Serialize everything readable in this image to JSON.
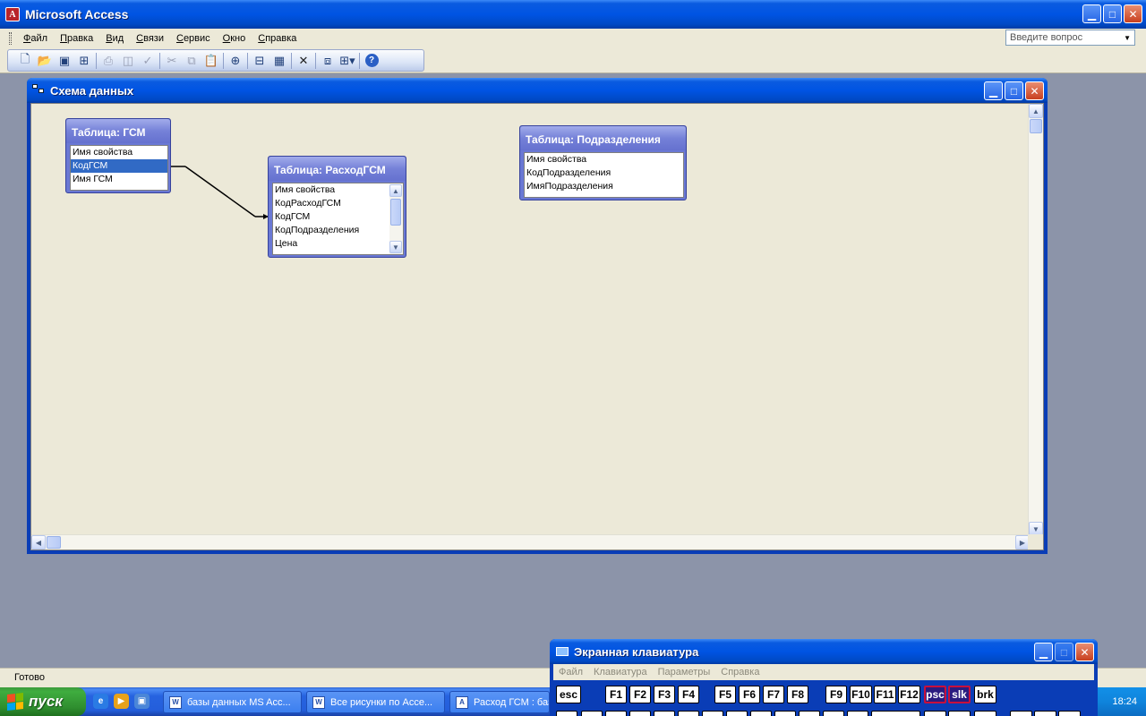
{
  "app": {
    "title": "Microsoft Access"
  },
  "menubar": {
    "items": [
      "Файл",
      "Правка",
      "Вид",
      "Связи",
      "Сервис",
      "Окно",
      "Справка"
    ],
    "ask_placeholder": "Введите вопрос"
  },
  "toolbar": {
    "buttons": [
      "new-icon",
      "open-icon",
      "save-icon",
      "table-prop-icon",
      "print-icon",
      "preview-icon",
      "spellcheck-icon",
      "cut-icon",
      "copy-icon",
      "paste-icon",
      "show-table-icon",
      "direct-relations-icon",
      "all-relations-icon",
      "delete-icon",
      "database-window-icon",
      "new-object-icon",
      "help-icon"
    ]
  },
  "window": {
    "title": "Схема данных"
  },
  "tables": [
    {
      "title": "Таблица: ГСМ",
      "fields": [
        "Имя свойства",
        "КодГСМ",
        "Имя ГСМ"
      ],
      "selected": 1
    },
    {
      "title": "Таблица: РасходГСМ",
      "fields": [
        "Имя свойства",
        "КодРасходГСМ",
        "КодГСМ",
        "КодПодразделения",
        "Цена"
      ],
      "selected": -1
    },
    {
      "title": "Таблица: Подразделения",
      "fields": [
        "Имя свойства",
        "КодПодразделения",
        "ИмяПодразделения"
      ],
      "selected": -1
    }
  ],
  "status": {
    "text": "Готово"
  },
  "taskbar": {
    "start": "пуск",
    "tasks": [
      "базы данных MS Acc...",
      "Все рисунки по Acce...",
      "Расход ГСМ : база..."
    ],
    "clock": "18:24"
  },
  "osk": {
    "title": "Экранная клавиатура",
    "menu": [
      "Файл",
      "Клавиатура",
      "Параметры",
      "Справка"
    ],
    "keys": [
      "esc",
      "F1",
      "F2",
      "F3",
      "F4",
      "F5",
      "F6",
      "F7",
      "F8",
      "F9",
      "F10",
      "F11",
      "F12",
      "psc",
      "slk",
      "brk"
    ]
  },
  "colors": {
    "titlebar": "#0054e3",
    "field_list_title": "#6a78d4",
    "selection": "#316ac5",
    "canvas": "#ece9d8",
    "desktop": "#8c94a9"
  }
}
